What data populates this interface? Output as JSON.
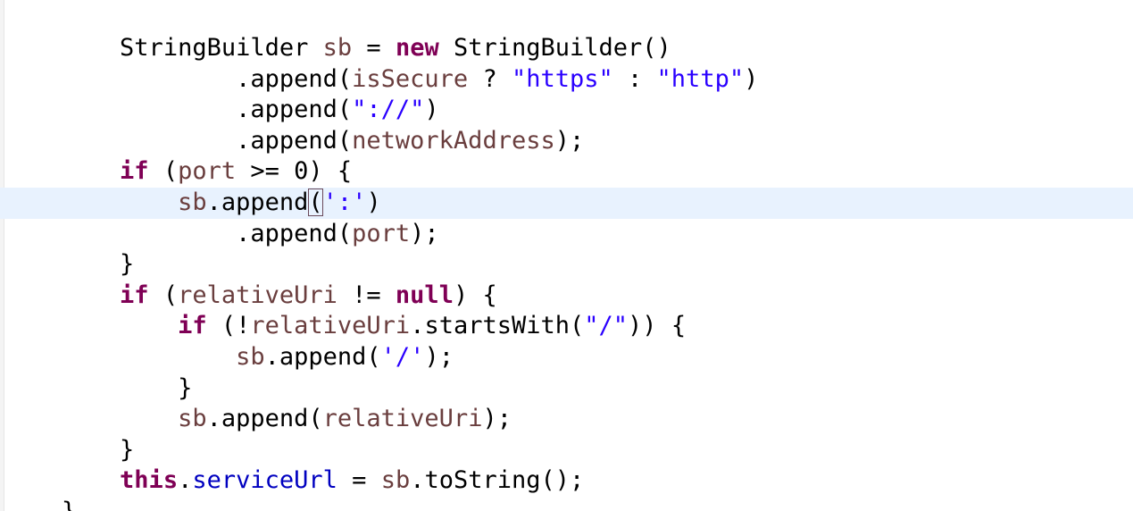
{
  "editor": {
    "colors": {
      "keyword": "#7f0055",
      "string": "#2a00ff",
      "field": "#0000c0",
      "local_variable": "#6a3e3e",
      "plain": "#000000",
      "current_line_highlight": "#e8f2fe",
      "background": "#ffffff"
    },
    "current_line_index": 5,
    "lines": [
      {
        "tokens": [
          {
            "t": "        ",
            "k": "plain"
          },
          {
            "t": "StringBuilder",
            "k": "plain"
          },
          {
            "t": " ",
            "k": "plain"
          },
          {
            "t": "sb",
            "k": "var"
          },
          {
            "t": " = ",
            "k": "plain"
          },
          {
            "t": "new",
            "k": "kw"
          },
          {
            "t": " StringBuilder()",
            "k": "plain"
          }
        ]
      },
      {
        "tokens": [
          {
            "t": "                ",
            "k": "plain"
          },
          {
            "t": ".append(",
            "k": "plain"
          },
          {
            "t": "isSecure",
            "k": "var"
          },
          {
            "t": " ? ",
            "k": "plain"
          },
          {
            "t": "\"https\"",
            "k": "str"
          },
          {
            "t": " : ",
            "k": "plain"
          },
          {
            "t": "\"http\"",
            "k": "str"
          },
          {
            "t": ")",
            "k": "plain"
          }
        ]
      },
      {
        "tokens": [
          {
            "t": "                ",
            "k": "plain"
          },
          {
            "t": ".append(",
            "k": "plain"
          },
          {
            "t": "\"://\"",
            "k": "str"
          },
          {
            "t": ")",
            "k": "plain"
          }
        ]
      },
      {
        "tokens": [
          {
            "t": "                ",
            "k": "plain"
          },
          {
            "t": ".append(",
            "k": "plain"
          },
          {
            "t": "networkAddress",
            "k": "var"
          },
          {
            "t": ");",
            "k": "plain"
          }
        ]
      },
      {
        "tokens": [
          {
            "t": "        ",
            "k": "plain"
          },
          {
            "t": "if",
            "k": "kw"
          },
          {
            "t": " (",
            "k": "plain"
          },
          {
            "t": "port",
            "k": "var"
          },
          {
            "t": " >= 0) {",
            "k": "plain"
          }
        ]
      },
      {
        "tokens": [
          {
            "t": "            ",
            "k": "plain"
          },
          {
            "t": "sb",
            "k": "var"
          },
          {
            "t": ".append",
            "k": "plain"
          },
          {
            "t": "(",
            "k": "plain",
            "match": true
          },
          {
            "t": "':'",
            "k": "str"
          },
          {
            "t": ")",
            "k": "plain"
          }
        ]
      },
      {
        "tokens": [
          {
            "t": "                ",
            "k": "plain"
          },
          {
            "t": ".append(",
            "k": "plain"
          },
          {
            "t": "port",
            "k": "var"
          },
          {
            "t": ");",
            "k": "plain"
          }
        ]
      },
      {
        "tokens": [
          {
            "t": "        ",
            "k": "plain"
          },
          {
            "t": "}",
            "k": "plain"
          }
        ]
      },
      {
        "tokens": [
          {
            "t": "        ",
            "k": "plain"
          },
          {
            "t": "if",
            "k": "kw"
          },
          {
            "t": " (",
            "k": "plain"
          },
          {
            "t": "relativeUri",
            "k": "var"
          },
          {
            "t": " != ",
            "k": "plain"
          },
          {
            "t": "null",
            "k": "kw"
          },
          {
            "t": ") {",
            "k": "plain"
          }
        ]
      },
      {
        "tokens": [
          {
            "t": "            ",
            "k": "plain"
          },
          {
            "t": "if",
            "k": "kw"
          },
          {
            "t": " (!",
            "k": "plain"
          },
          {
            "t": "relativeUri",
            "k": "var"
          },
          {
            "t": ".startsWith(",
            "k": "plain"
          },
          {
            "t": "\"/\"",
            "k": "str"
          },
          {
            "t": ")) {",
            "k": "plain"
          }
        ]
      },
      {
        "tokens": [
          {
            "t": "                ",
            "k": "plain"
          },
          {
            "t": "sb",
            "k": "var"
          },
          {
            "t": ".append(",
            "k": "plain"
          },
          {
            "t": "'/'",
            "k": "str"
          },
          {
            "t": ");",
            "k": "plain"
          }
        ]
      },
      {
        "tokens": [
          {
            "t": "            ",
            "k": "plain"
          },
          {
            "t": "}",
            "k": "plain"
          }
        ]
      },
      {
        "tokens": [
          {
            "t": "            ",
            "k": "plain"
          },
          {
            "t": "sb",
            "k": "var"
          },
          {
            "t": ".append(",
            "k": "plain"
          },
          {
            "t": "relativeUri",
            "k": "var"
          },
          {
            "t": ");",
            "k": "plain"
          }
        ]
      },
      {
        "tokens": [
          {
            "t": "        ",
            "k": "plain"
          },
          {
            "t": "}",
            "k": "plain"
          }
        ]
      },
      {
        "tokens": [
          {
            "t": "        ",
            "k": "plain"
          },
          {
            "t": "this",
            "k": "kw"
          },
          {
            "t": ".",
            "k": "plain"
          },
          {
            "t": "serviceUrl",
            "k": "fld"
          },
          {
            "t": " = ",
            "k": "plain"
          },
          {
            "t": "sb",
            "k": "var"
          },
          {
            "t": ".toString();",
            "k": "plain"
          }
        ]
      },
      {
        "tokens": [
          {
            "t": "    ",
            "k": "plain"
          },
          {
            "t": "}",
            "k": "plain"
          }
        ]
      }
    ]
  }
}
